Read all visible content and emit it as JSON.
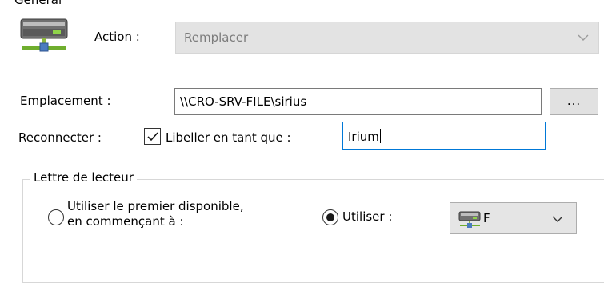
{
  "clipped_top_text": "Général",
  "action": {
    "label": "Action :",
    "value": "Remplacer",
    "icon": "network-drive-icon"
  },
  "location": {
    "label": "Emplacement :",
    "value": "\\\\CRO-SRV-FILE\\sirius",
    "browse_label": "..."
  },
  "reconnect": {
    "label": "Reconnecter :",
    "checked": true
  },
  "label_as": {
    "label": "Libeller en tant que :",
    "value": "Irium"
  },
  "drive_letter": {
    "group_title": "Lettre de lecteur",
    "option_first_available": "Utiliser le premier disponible,\nen commençant à :",
    "option_use": "Utiliser :",
    "selected_option": "use",
    "selected_letter": "F"
  },
  "colors": {
    "focus_border": "#0078d7",
    "disabled_bg": "#e3e3e3",
    "disabled_text": "#7c7c7c"
  }
}
